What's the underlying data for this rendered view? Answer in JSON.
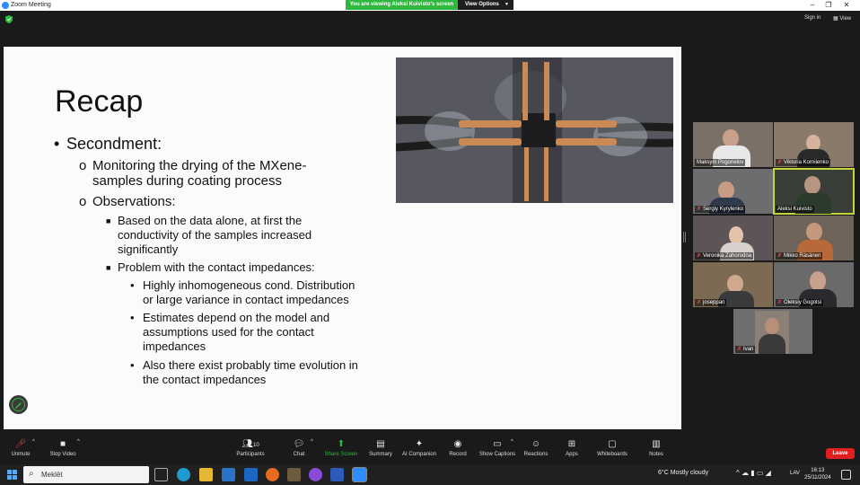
{
  "window": {
    "title": "Zoom Meeting",
    "share_banner": "You are viewing Aleksi Kuivisto's screen",
    "view_options": "View Options",
    "minimize": "–",
    "maximize": "❐",
    "close": "✕"
  },
  "header": {
    "sign_in": "Sign in",
    "view": "View"
  },
  "slide": {
    "title": "Recap",
    "l1": "Secondment:",
    "l2a": "Monitoring the drying of the MXene-",
    "l2a2": "samples during coating process",
    "l2b": "Observations:",
    "l3a_1": "Based on the data alone, at first the",
    "l3a_2": "conductivity of the samples increased",
    "l3a_3": "significantly",
    "l3b": "Problem with the contact impedances:",
    "l4a_1": "Highly inhomogeneous cond. Distribution",
    "l4a_2": "or large variance in contact impedances",
    "l4b_1": "Estimates depend on the model and",
    "l4b_2": "assumptions used for the contact",
    "l4b_3": "impedances",
    "l4c_1": "Also there exist probably time evolution in",
    "l4c_2": "the contact impedances"
  },
  "participants": [
    {
      "name": "Maksym Pogorielov",
      "muted": false
    },
    {
      "name": "Viktoria Korniienko",
      "muted": true
    },
    {
      "name": "Sergiy Kyrylenko",
      "muted": true
    },
    {
      "name": "Aleksi Kuivisto",
      "muted": false
    },
    {
      "name": "Veronika Zahorodna",
      "muted": true
    },
    {
      "name": "Mikko Räsänen",
      "muted": true
    },
    {
      "name": "joseppan",
      "muted": true
    },
    {
      "name": "Oleksiy Gogotsi",
      "muted": true
    },
    {
      "name": "Ivan",
      "muted": true
    }
  ],
  "toolbar": {
    "unmute": "Unmute",
    "stop_video": "Stop Video",
    "participants": "Participants",
    "participants_count": "10",
    "chat": "Chat",
    "share_screen": "Share Screen",
    "summary": "Summary",
    "ai_companion": "AI Companion",
    "record": "Record",
    "show_captions": "Show Captions",
    "reactions": "Reactions",
    "apps": "Apps",
    "whiteboards": "Whiteboards",
    "notes": "Notes",
    "leave": "Leave"
  },
  "taskbar": {
    "search_placeholder": "Meklēt",
    "weather": "6°C  Mostly cloudy",
    "language": "LAV",
    "time": "16:13",
    "date": "25/11/2024"
  },
  "colors": {
    "accent_green": "#2eb83d",
    "leave_red": "#e02020",
    "active_speaker": "#c5d63b",
    "zoom_blue": "#2d8cff"
  }
}
